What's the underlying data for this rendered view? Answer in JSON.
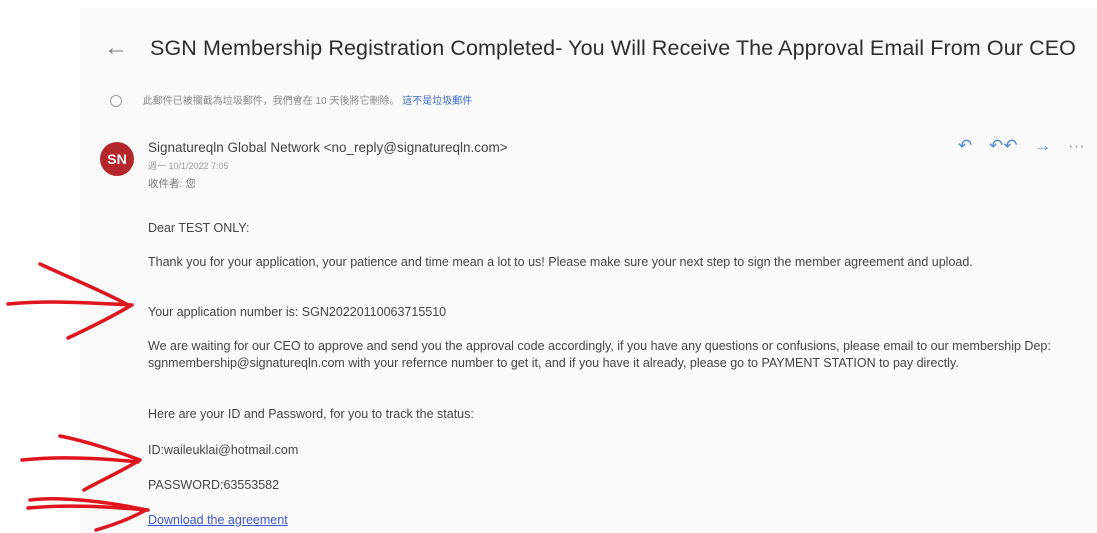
{
  "email": {
    "back_icon": "arrow-left-icon",
    "subject": "SGN Membership Registration Completed- You Will Receive The Approval Email From Our CEO",
    "notice": {
      "icon": "info-icon",
      "text": "此郵件已被攔截為垃圾郵件，我們會在 10 天後將它刪除。",
      "link": "這不是垃圾郵件"
    },
    "sender": {
      "avatar_initials": "SN",
      "avatar_color": "#b3262b",
      "name_email": "Signatureqln Global Network <no_reply@signatureqln.com>",
      "date": "週一 10/1/2022 7:05",
      "recipient": "收件者: 您"
    },
    "actions": {
      "reply": "↶",
      "reply_all": "↶↶",
      "forward": "→",
      "more": "···"
    },
    "body": {
      "greeting": "Dear TEST ONLY:",
      "thanks": "Thank you for your application, your patience and time mean a lot to us! Please make sure your next step to sign the member agreement and upload.",
      "app_number": "Your application number is: SGN20220110063715510",
      "waiting": "We are waiting for our CEO to approve and send you the approval code accordingly, if you have any questions or confusions, please email to our membership Dep: sgnmembership@signatureqln.com with your refernce number to get it, and if you have it already, please go to PAYMENT STATION to pay directly.",
      "here": "Here are your ID and Password, for you to track the status:",
      "id": "ID:waileuklai@hotmail.com",
      "password": "PASSWORD:63553582",
      "download_link": "Download the agreement"
    },
    "annotation_color": "#e0141c"
  }
}
